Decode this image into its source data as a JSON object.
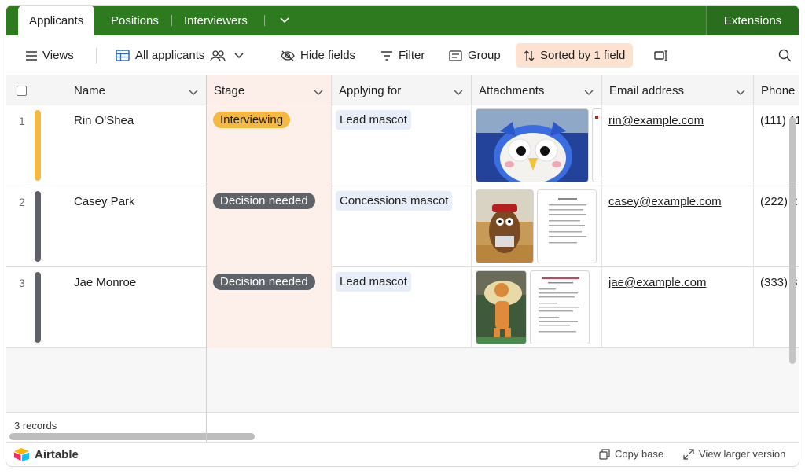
{
  "tabs": [
    {
      "label": "Applicants",
      "active": true
    },
    {
      "label": "Positions"
    },
    {
      "label": "Interviewers"
    }
  ],
  "extensions_label": "Extensions",
  "toolbar": {
    "views": "Views",
    "view_name": "All applicants",
    "hide_fields": "Hide fields",
    "filter": "Filter",
    "group": "Group",
    "sort": "Sorted by 1 field"
  },
  "columns": [
    "Name",
    "Stage",
    "Applying for",
    "Attachments",
    "Email address",
    "Phone"
  ],
  "rows": [
    {
      "num": "1",
      "name": "Rin O'Shea",
      "stage": "Interviewing",
      "applying": "Lead mascot",
      "email": "rin@example.com",
      "phone": "(111) 11",
      "bar_color": "#f5b942",
      "stage_color": "#f5b942",
      "stage_text_color": "#1f1f1f"
    },
    {
      "num": "2",
      "name": "Casey Park",
      "stage": "Decision needed",
      "applying": "Concessions mascot",
      "email": "casey@example.com",
      "phone": "(222) 2",
      "bar_color": "#5f6369",
      "stage_color": "#5f6369",
      "stage_text_color": "#ffffff"
    },
    {
      "num": "3",
      "name": "Jae Monroe",
      "stage": "Decision needed",
      "applying": "Lead mascot",
      "email": "jae@example.com",
      "phone": "(333) 3",
      "bar_color": "#5f6369",
      "stage_color": "#5f6369",
      "stage_text_color": "#ffffff"
    }
  ],
  "records": "3 records",
  "bottom": {
    "brand": "Airtable",
    "copy_base": "Copy base",
    "view_larger": "View larger version"
  },
  "colors": {
    "topbar": "#2d7a1f",
    "sorted_bg": "#fde2d1",
    "stage_col_bg": "#fdf0ea"
  }
}
